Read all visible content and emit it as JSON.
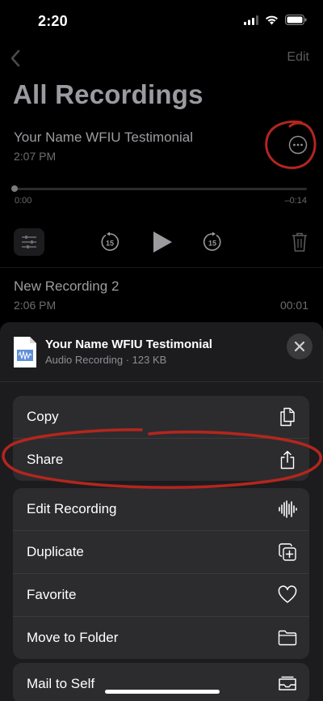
{
  "status_bar": {
    "time": "2:20"
  },
  "nav": {
    "edit_label": "Edit"
  },
  "page_title": "All Recordings",
  "recordings": [
    {
      "name": "Your Name WFIU Testimonial",
      "date": "2:07 PM",
      "time_start": "0:00",
      "time_end": "–0:14"
    },
    {
      "name": "New Recording 2",
      "date": "2:06 PM",
      "duration": "00:01"
    }
  ],
  "controls": {
    "skip_back_label": "15",
    "skip_forward_label": "15"
  },
  "sheet": {
    "title": "Your Name WFIU Testimonial",
    "subtitle": "Audio Recording · 123 KB",
    "groups": [
      [
        {
          "label": "Copy",
          "icon": "copy-icon"
        },
        {
          "label": "Share",
          "icon": "share-icon"
        }
      ],
      [
        {
          "label": "Edit Recording",
          "icon": "waveform-icon"
        },
        {
          "label": "Duplicate",
          "icon": "duplicate-icon"
        },
        {
          "label": "Favorite",
          "icon": "heart-icon"
        },
        {
          "label": "Move to Folder",
          "icon": "folder-icon"
        }
      ],
      [
        {
          "label": "Mail to Self",
          "icon": "mail-icon"
        }
      ]
    ]
  },
  "colors": {
    "background": "#000000",
    "sheet": "#1c1c1e",
    "row": "#2c2c2e",
    "annotation": "#b3261e"
  }
}
